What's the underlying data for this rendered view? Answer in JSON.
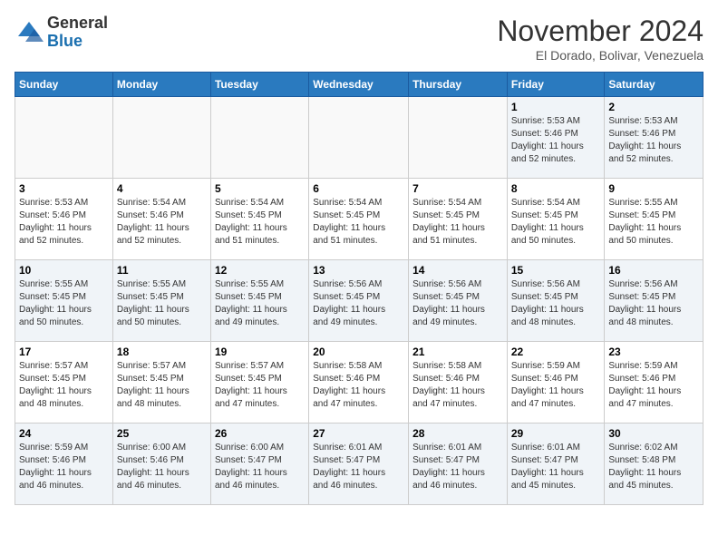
{
  "logo": {
    "general": "General",
    "blue": "Blue"
  },
  "header": {
    "month_year": "November 2024",
    "location": "El Dorado, Bolivar, Venezuela"
  },
  "weekdays": [
    "Sunday",
    "Monday",
    "Tuesday",
    "Wednesday",
    "Thursday",
    "Friday",
    "Saturday"
  ],
  "weeks": [
    [
      {
        "day": "",
        "info": ""
      },
      {
        "day": "",
        "info": ""
      },
      {
        "day": "",
        "info": ""
      },
      {
        "day": "",
        "info": ""
      },
      {
        "day": "",
        "info": ""
      },
      {
        "day": "1",
        "info": "Sunrise: 5:53 AM\nSunset: 5:46 PM\nDaylight: 11 hours\nand 52 minutes."
      },
      {
        "day": "2",
        "info": "Sunrise: 5:53 AM\nSunset: 5:46 PM\nDaylight: 11 hours\nand 52 minutes."
      }
    ],
    [
      {
        "day": "3",
        "info": "Sunrise: 5:53 AM\nSunset: 5:46 PM\nDaylight: 11 hours\nand 52 minutes."
      },
      {
        "day": "4",
        "info": "Sunrise: 5:54 AM\nSunset: 5:46 PM\nDaylight: 11 hours\nand 52 minutes."
      },
      {
        "day": "5",
        "info": "Sunrise: 5:54 AM\nSunset: 5:45 PM\nDaylight: 11 hours\nand 51 minutes."
      },
      {
        "day": "6",
        "info": "Sunrise: 5:54 AM\nSunset: 5:45 PM\nDaylight: 11 hours\nand 51 minutes."
      },
      {
        "day": "7",
        "info": "Sunrise: 5:54 AM\nSunset: 5:45 PM\nDaylight: 11 hours\nand 51 minutes."
      },
      {
        "day": "8",
        "info": "Sunrise: 5:54 AM\nSunset: 5:45 PM\nDaylight: 11 hours\nand 50 minutes."
      },
      {
        "day": "9",
        "info": "Sunrise: 5:55 AM\nSunset: 5:45 PM\nDaylight: 11 hours\nand 50 minutes."
      }
    ],
    [
      {
        "day": "10",
        "info": "Sunrise: 5:55 AM\nSunset: 5:45 PM\nDaylight: 11 hours\nand 50 minutes."
      },
      {
        "day": "11",
        "info": "Sunrise: 5:55 AM\nSunset: 5:45 PM\nDaylight: 11 hours\nand 50 minutes."
      },
      {
        "day": "12",
        "info": "Sunrise: 5:55 AM\nSunset: 5:45 PM\nDaylight: 11 hours\nand 49 minutes."
      },
      {
        "day": "13",
        "info": "Sunrise: 5:56 AM\nSunset: 5:45 PM\nDaylight: 11 hours\nand 49 minutes."
      },
      {
        "day": "14",
        "info": "Sunrise: 5:56 AM\nSunset: 5:45 PM\nDaylight: 11 hours\nand 49 minutes."
      },
      {
        "day": "15",
        "info": "Sunrise: 5:56 AM\nSunset: 5:45 PM\nDaylight: 11 hours\nand 48 minutes."
      },
      {
        "day": "16",
        "info": "Sunrise: 5:56 AM\nSunset: 5:45 PM\nDaylight: 11 hours\nand 48 minutes."
      }
    ],
    [
      {
        "day": "17",
        "info": "Sunrise: 5:57 AM\nSunset: 5:45 PM\nDaylight: 11 hours\nand 48 minutes."
      },
      {
        "day": "18",
        "info": "Sunrise: 5:57 AM\nSunset: 5:45 PM\nDaylight: 11 hours\nand 48 minutes."
      },
      {
        "day": "19",
        "info": "Sunrise: 5:57 AM\nSunset: 5:45 PM\nDaylight: 11 hours\nand 47 minutes."
      },
      {
        "day": "20",
        "info": "Sunrise: 5:58 AM\nSunset: 5:46 PM\nDaylight: 11 hours\nand 47 minutes."
      },
      {
        "day": "21",
        "info": "Sunrise: 5:58 AM\nSunset: 5:46 PM\nDaylight: 11 hours\nand 47 minutes."
      },
      {
        "day": "22",
        "info": "Sunrise: 5:59 AM\nSunset: 5:46 PM\nDaylight: 11 hours\nand 47 minutes."
      },
      {
        "day": "23",
        "info": "Sunrise: 5:59 AM\nSunset: 5:46 PM\nDaylight: 11 hours\nand 47 minutes."
      }
    ],
    [
      {
        "day": "24",
        "info": "Sunrise: 5:59 AM\nSunset: 5:46 PM\nDaylight: 11 hours\nand 46 minutes."
      },
      {
        "day": "25",
        "info": "Sunrise: 6:00 AM\nSunset: 5:46 PM\nDaylight: 11 hours\nand 46 minutes."
      },
      {
        "day": "26",
        "info": "Sunrise: 6:00 AM\nSunset: 5:47 PM\nDaylight: 11 hours\nand 46 minutes."
      },
      {
        "day": "27",
        "info": "Sunrise: 6:01 AM\nSunset: 5:47 PM\nDaylight: 11 hours\nand 46 minutes."
      },
      {
        "day": "28",
        "info": "Sunrise: 6:01 AM\nSunset: 5:47 PM\nDaylight: 11 hours\nand 46 minutes."
      },
      {
        "day": "29",
        "info": "Sunrise: 6:01 AM\nSunset: 5:47 PM\nDaylight: 11 hours\nand 45 minutes."
      },
      {
        "day": "30",
        "info": "Sunrise: 6:02 AM\nSunset: 5:48 PM\nDaylight: 11 hours\nand 45 minutes."
      }
    ]
  ]
}
